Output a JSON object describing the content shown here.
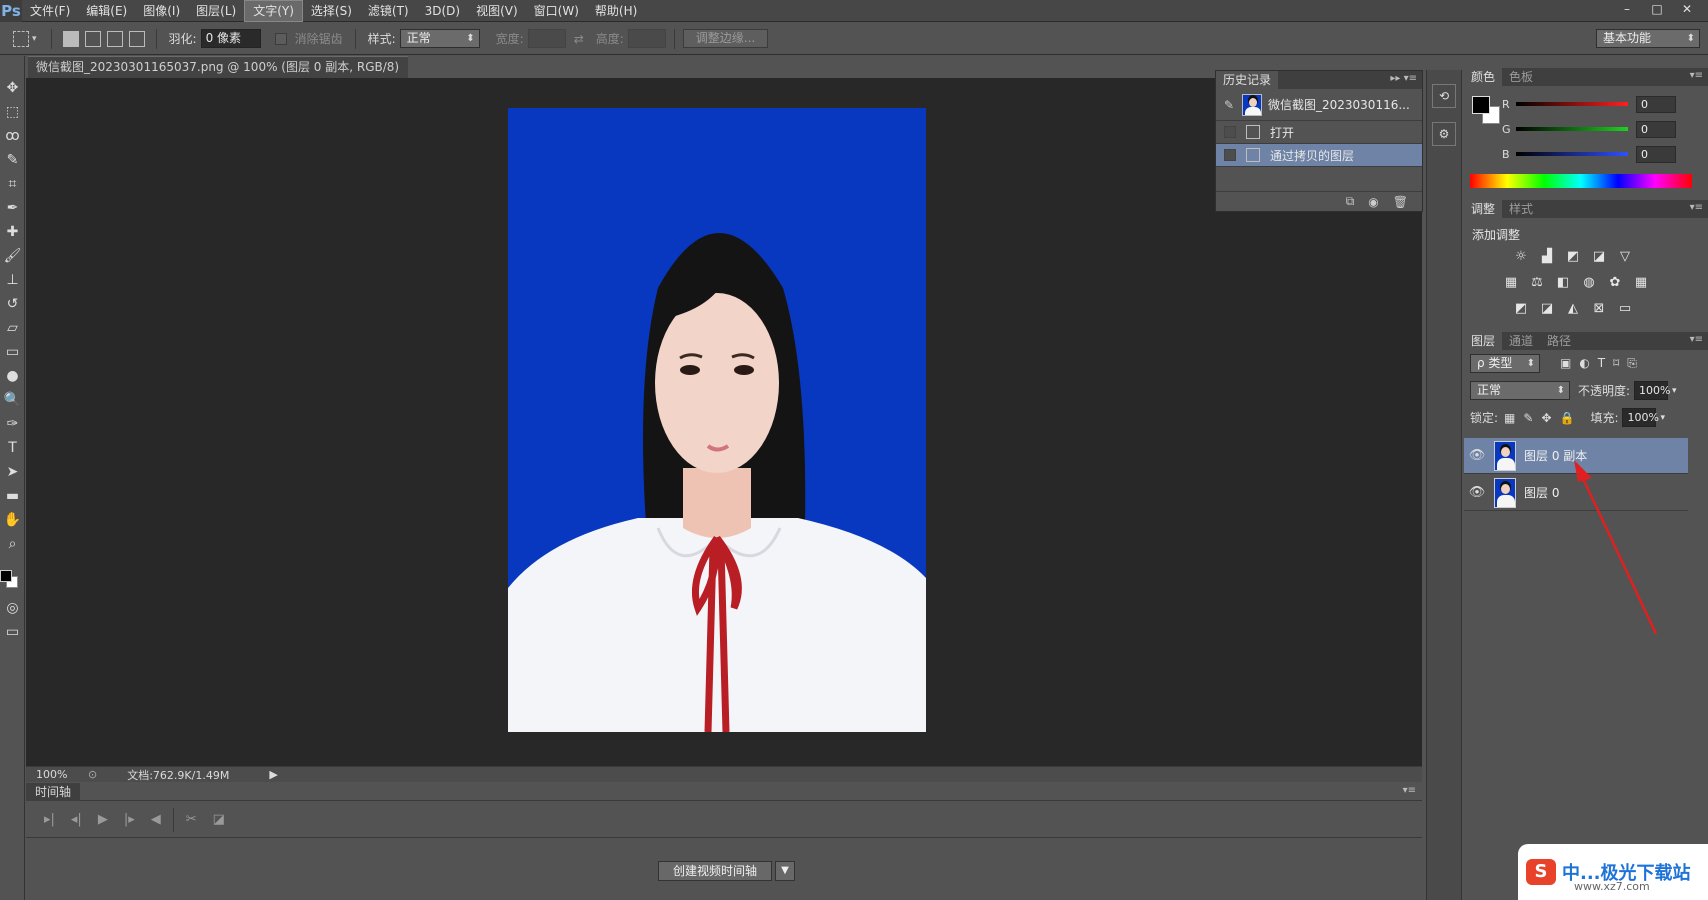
{
  "app": {
    "logo": "Ps"
  },
  "menu": {
    "items": [
      "文件(F)",
      "编辑(E)",
      "图像(I)",
      "图层(L)",
      "文字(Y)",
      "选择(S)",
      "滤镜(T)",
      "3D(D)",
      "视图(V)",
      "窗口(W)",
      "帮助(H)"
    ]
  },
  "window_buttons": [
    "–",
    "□",
    "✕"
  ],
  "options": {
    "feather_label": "羽化:",
    "feather_value": "0 像素",
    "antialias_label": "消除锯齿",
    "style_label": "样式:",
    "style_value": "正常",
    "width_label": "宽度:",
    "height_label": "高度:",
    "refine_edge": "调整边缘...",
    "workspace": "基本功能"
  },
  "document": {
    "tab_title": "微信截图_20230301165037.png @ 100% (图层 0 副本, RGB/8) *",
    "close": "×"
  },
  "status": {
    "zoom": "100%",
    "doc_info": "文档:762.9K/1.49M",
    "arrow": "▶"
  },
  "timeline": {
    "tab": "时间轴",
    "create_button": "创建视频时间轴",
    "dropdown_icon": "▼"
  },
  "history": {
    "tabs": [
      "历史记录"
    ],
    "snapshot": "微信截图_2023030116...",
    "items": [
      "打开",
      "通过拷贝的图层"
    ]
  },
  "color_panel": {
    "tabs": [
      "颜色",
      "色板"
    ],
    "channels": [
      {
        "label": "R",
        "value": "0",
        "color": "#ff2020"
      },
      {
        "label": "G",
        "value": "0",
        "color": "#20d020"
      },
      {
        "label": "B",
        "value": "0",
        "color": "#3050ff"
      }
    ]
  },
  "adjustments": {
    "tabs": [
      "调整",
      "样式"
    ],
    "title": "添加调整"
  },
  "layers": {
    "tabs": [
      "图层",
      "通道",
      "路径"
    ],
    "filter": "ρ 类型",
    "blend_mode": "正常",
    "opacity_label": "不透明度:",
    "opacity_value": "100%",
    "lock_label": "锁定:",
    "fill_label": "填充:",
    "fill_value": "100%",
    "items": [
      {
        "name": "图层 0 副本",
        "selected": true
      },
      {
        "name": "图层 0",
        "selected": false
      }
    ]
  },
  "watermark": {
    "logo": "S",
    "text": "中...极光下载站",
    "url": "www.xz7.com"
  },
  "colors": {
    "photo_bg": "#0838c0",
    "selection": "#6e83a6",
    "annotation_arrow": "#e02020"
  }
}
